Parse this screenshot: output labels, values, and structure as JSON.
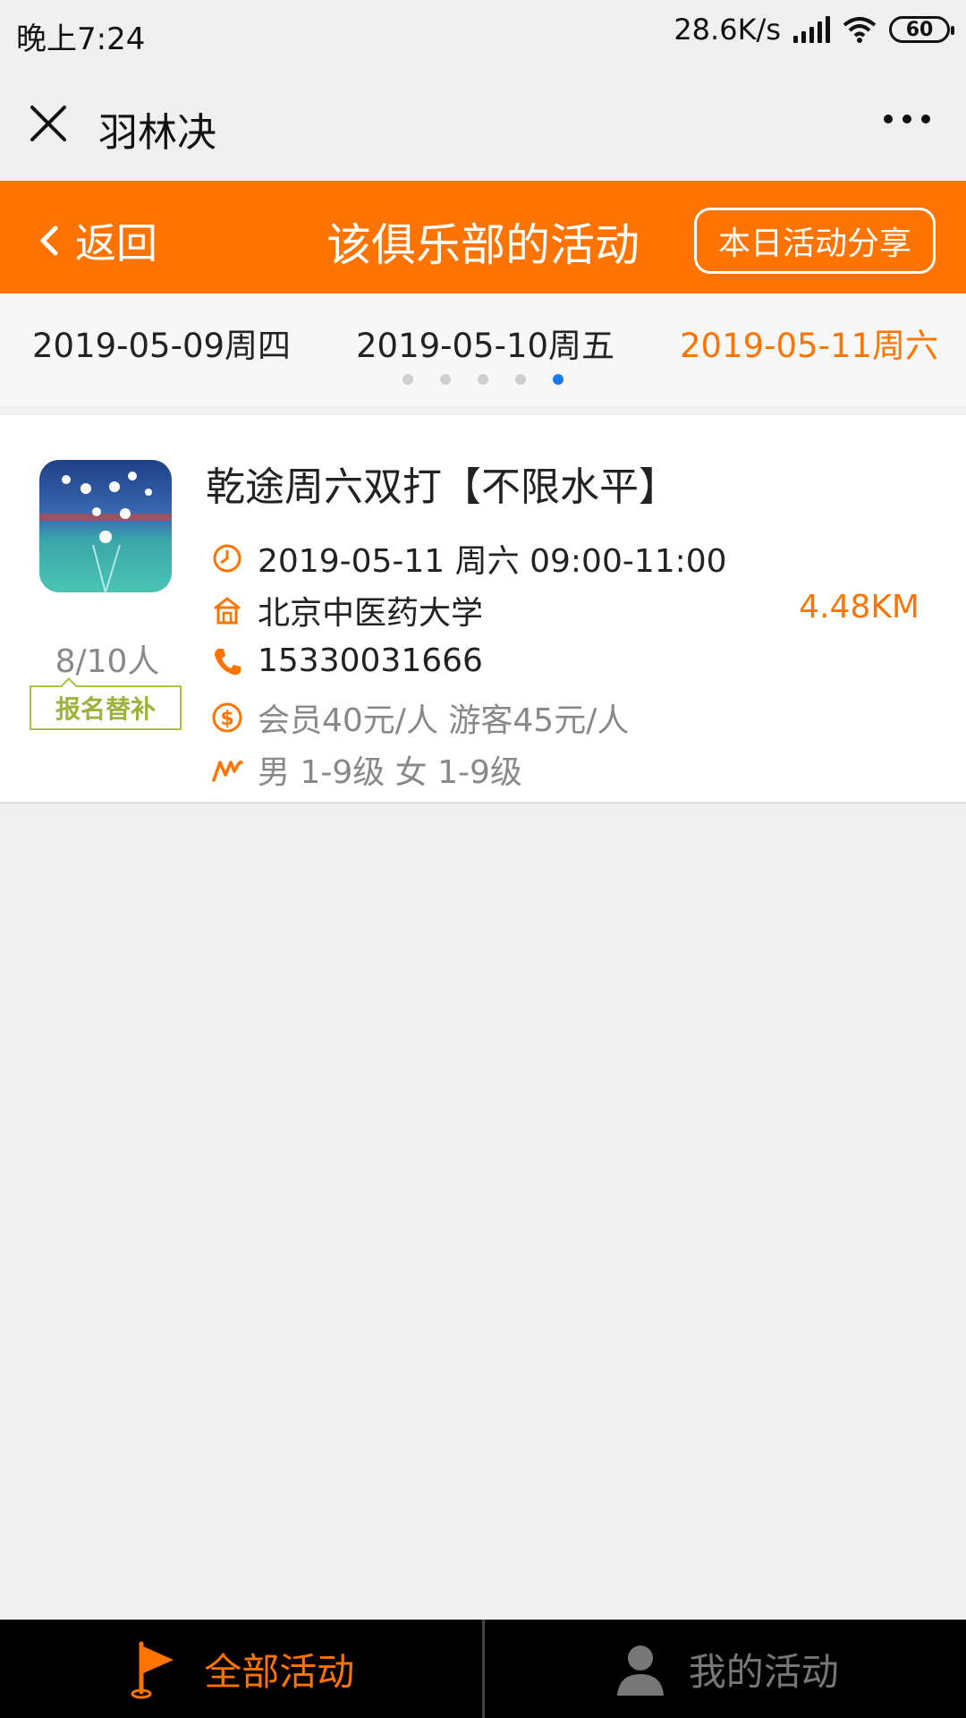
{
  "status_bar": {
    "time": "晚上7:24",
    "network_speed": "28.6K/s",
    "battery": "60"
  },
  "wechat_bar": {
    "title": "羽林决"
  },
  "header": {
    "back_label": "返回",
    "title": "该俱乐部的活动",
    "share_label": "本日活动分享",
    "color": "#ff7300"
  },
  "date_strip": {
    "dates": [
      "2019-05-09周四",
      "2019-05-10周五",
      "2019-05-11周六"
    ],
    "selected_index": 2,
    "page_count": 5,
    "current_page": 5
  },
  "activity": {
    "title": "乾途周六双打【不限水平】",
    "time": "2019-05-11 周六 09:00-11:00",
    "venue": "北京中医药大学",
    "distance": "4.48KM",
    "phone": "15330031666",
    "price": "会员40元/人 游客45元/人",
    "level": "男 1-9级 女 1-9级",
    "count": "8/10人",
    "status_tag": "报名替补"
  },
  "tabbar": {
    "all_label": "全部活动",
    "mine_label": "我的活动"
  }
}
